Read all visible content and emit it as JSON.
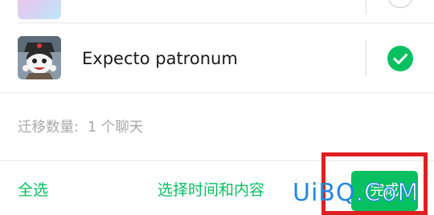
{
  "list": {
    "selected_chat": {
      "name": "Expecto patronum",
      "selected": true,
      "avatar_icon": "cartoon-character-avatar"
    }
  },
  "summary": {
    "label": "迁移数量:",
    "value": "1 个聊天"
  },
  "footer": {
    "select_all_label": "全选",
    "select_time_label": "选择时间和内容",
    "done_label": "完成"
  },
  "watermark": {
    "part1": "UiBQ",
    "part2": ".",
    "part3": "CoM"
  },
  "colors": {
    "accent": "#07c160",
    "highlight_box": "#e02020",
    "watermark": "#1e88e5"
  }
}
